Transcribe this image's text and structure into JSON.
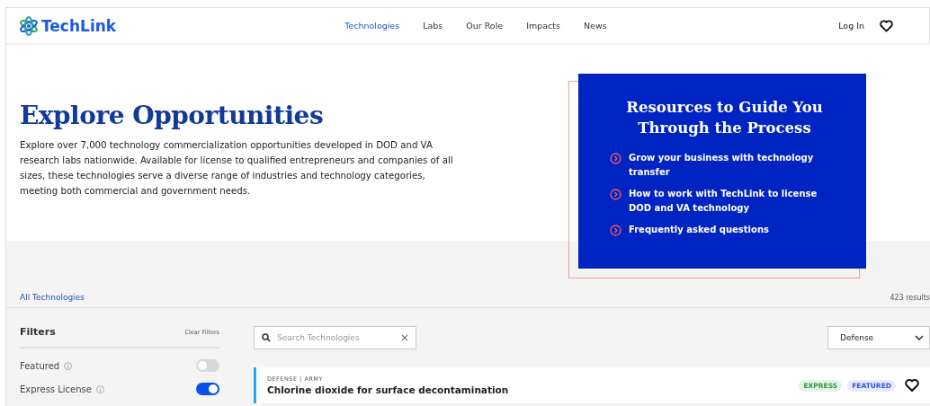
{
  "header": {
    "logo": "TechLink",
    "nav": [
      {
        "label": "Technologies",
        "selected": true
      },
      {
        "label": "Labs",
        "selected": false
      },
      {
        "label": "Our Role",
        "selected": false
      },
      {
        "label": "Impacts",
        "selected": false
      },
      {
        "label": "News",
        "selected": false
      }
    ],
    "login": "Log In"
  },
  "hero": {
    "title": "Explore Opportunities",
    "description": "Explore over 7,000 technology commercialization opportunities developed in DOD and VA research labs nationwide. Available for license to qualified entrepreneurs and companies of all sizes, these technologies serve a diverse range of industries and technology categories, meeting both commercial and government needs.",
    "resources": {
      "title": "Resources to Guide You Through the Process",
      "links": [
        "Grow your business with technology transfer",
        "How to work with TechLink to license DOD and VA technology",
        "Frequently asked questions"
      ]
    }
  },
  "listing": {
    "breadcrumb": "All Technologies",
    "results": "423 results",
    "filters": {
      "title": "Filters",
      "clear": "Clear Filters",
      "toggles": [
        {
          "label": "Featured",
          "on": false
        },
        {
          "label": "Express License",
          "on": true
        }
      ]
    },
    "search": {
      "placeholder": "Search Technologies"
    },
    "dropdown": {
      "value": "Defense"
    },
    "items": [
      {
        "category": "DEFENSE | ARMY",
        "title": "Chlorine dioxide for surface decontamination",
        "badges": [
          {
            "label": "EXPRESS",
            "kind": "express"
          },
          {
            "label": "FEATURED",
            "kind": "featured"
          }
        ]
      }
    ]
  }
}
